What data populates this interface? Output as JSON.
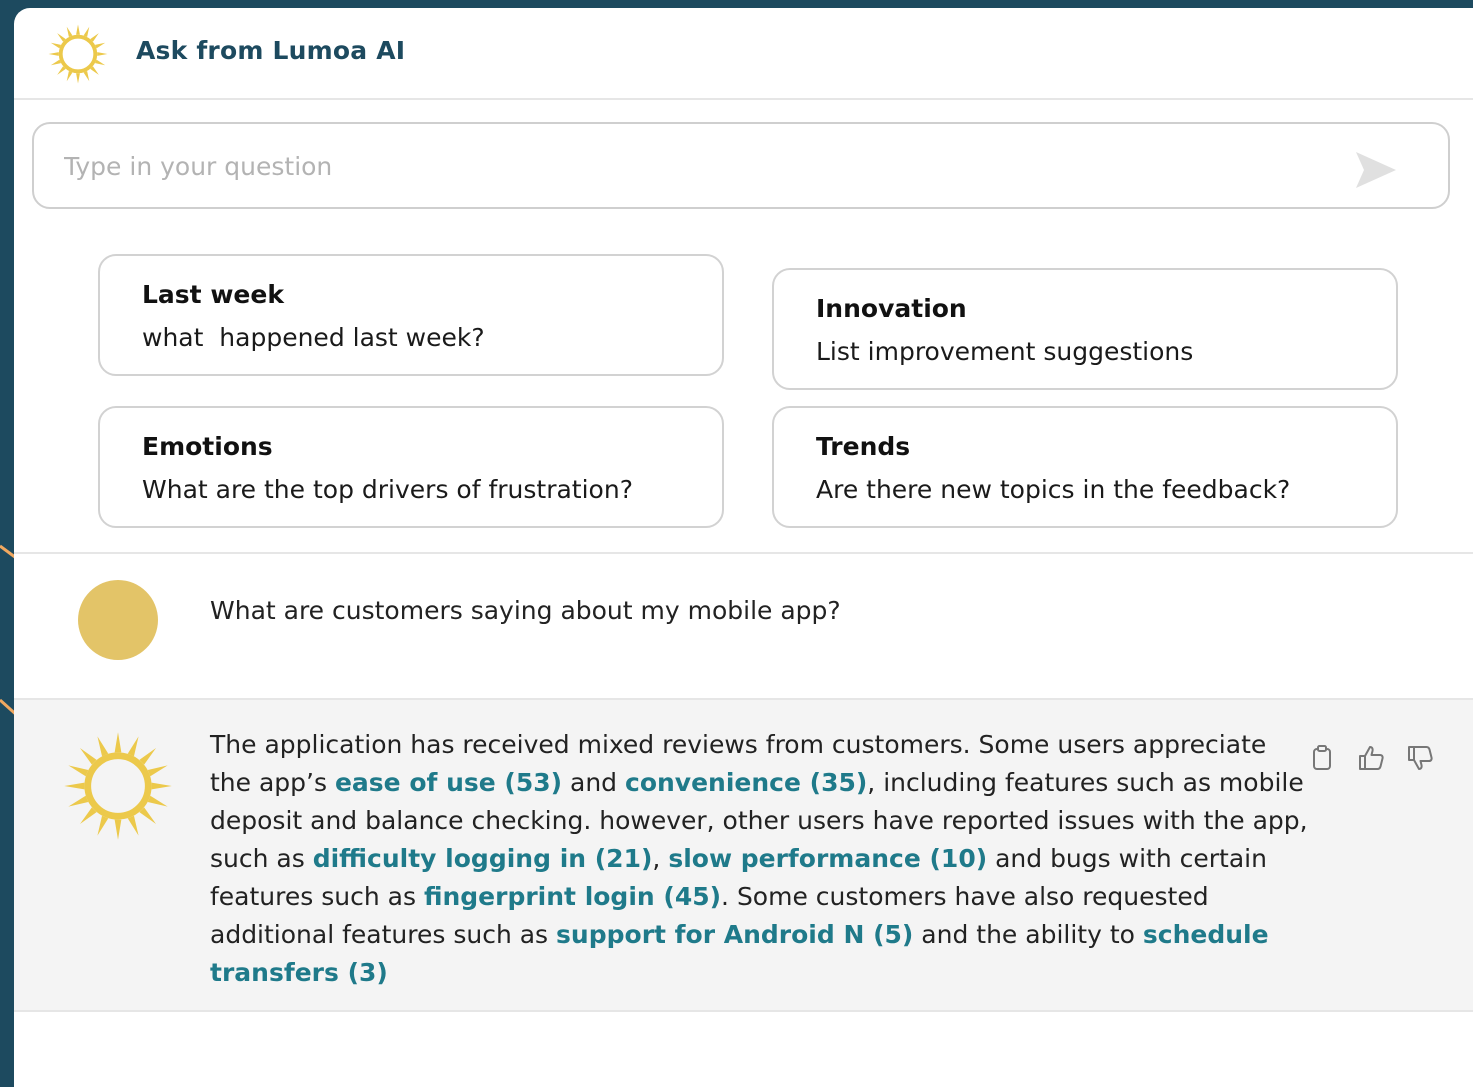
{
  "header": {
    "title": "Ask from Lumoa AI",
    "logo_icon": "sun-icon"
  },
  "search": {
    "placeholder": "Type in your question",
    "value": "",
    "send_icon": "send-icon"
  },
  "suggestions": [
    {
      "title": "Last week",
      "question": "what  happened last week?"
    },
    {
      "title": "Innovation",
      "question": "List improvement suggestions"
    },
    {
      "title": "Emotions",
      "question": "What are the top drivers of frustration?"
    },
    {
      "title": "Trends",
      "question": "Are there new topics in the feedback?"
    }
  ],
  "conversation": {
    "user_message": "What are customers saying about my mobile app?",
    "ai_response": {
      "t1": "The application has received mixed reviews from customers. Some users appreciate the app’s ",
      "l1": "ease of use (53)",
      "t2": " and ",
      "l2": "convenience (35)",
      "t3": ", including features such as mobile deposit and balance checking. however, other users have reported issues with the app, such as ",
      "l3": "difficulty logging in (21)",
      "t4": ", ",
      "l4": "slow performance (10)",
      "t5": " and bugs with certain features such as ",
      "l5": "fingerprint login (45)",
      "t6": ". Some customers have also requested additional features such as ",
      "l6": "support for Android N (5)",
      "t7": " and the ability to ",
      "l7": "schedule transfers (3)"
    },
    "actions": [
      "clipboard-icon",
      "thumbs-up-icon",
      "thumbs-down-icon"
    ]
  },
  "colors": {
    "brand": "#1d4a5f",
    "sun": "#ecc94b",
    "avatar": "#e3c468",
    "link": "#1f7a8a",
    "arrow": "#f0a860"
  }
}
